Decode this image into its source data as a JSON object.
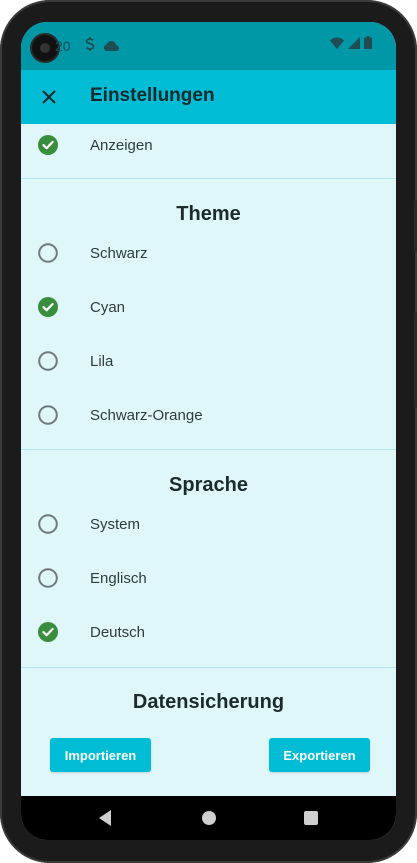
{
  "status_bar": {
    "time": "20",
    "icons": [
      "sync-icon",
      "cloud-icon",
      "wifi-icon",
      "signal-icon",
      "battery-icon"
    ]
  },
  "app_bar": {
    "title": "Einstellungen",
    "close_icon": "close-icon"
  },
  "top_item": {
    "label": "Anzeigen",
    "checked": true
  },
  "theme": {
    "title": "Theme",
    "options": [
      {
        "label": "Schwarz",
        "checked": false
      },
      {
        "label": "Cyan",
        "checked": true
      },
      {
        "label": "Lila",
        "checked": false
      },
      {
        "label": "Schwarz-Orange",
        "checked": false
      }
    ]
  },
  "language": {
    "title": "Sprache",
    "options": [
      {
        "label": "System",
        "checked": false
      },
      {
        "label": "Englisch",
        "checked": false
      },
      {
        "label": "Deutsch",
        "checked": true
      }
    ]
  },
  "backup": {
    "title": "Datensicherung",
    "import_label": "Importieren",
    "export_label": "Exportieren"
  },
  "colors": {
    "accent": "#00bcd4",
    "status_bar": "#0097a7",
    "background": "#e0f7fa",
    "check_green": "#388e3c",
    "radio_gray": "#6e7a7c"
  }
}
